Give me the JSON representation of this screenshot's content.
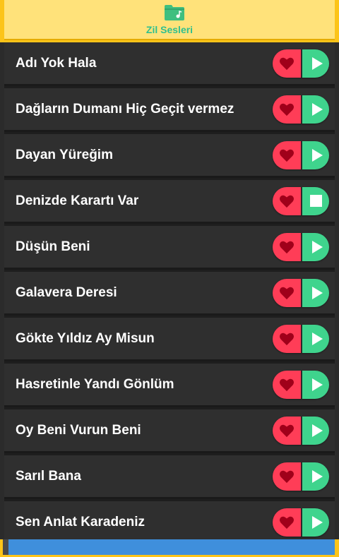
{
  "header": {
    "title": "Zil Sesleri",
    "icon": "folder-music-icon"
  },
  "colors": {
    "accent_yellow": "#fcc419",
    "title_green": "#2fbf8f",
    "favorite_red": "#ff3d57",
    "play_green": "#3fd48d"
  },
  "songs": [
    {
      "title": "Adı Yok Hala",
      "state": "play"
    },
    {
      "title": "Dağların Dumanı Hiç Geçit vermez",
      "state": "play"
    },
    {
      "title": "Dayan Yüreğim",
      "state": "play"
    },
    {
      "title": "Denizde Karartı Var",
      "state": "stop"
    },
    {
      "title": "Düşün Beni",
      "state": "play"
    },
    {
      "title": "Galavera Deresi",
      "state": "play"
    },
    {
      "title": "Gökte Yıldız Ay Misun",
      "state": "play"
    },
    {
      "title": "Hasretinle Yandı Gönlüm",
      "state": "play"
    },
    {
      "title": "Oy Beni Vurun Beni",
      "state": "play"
    },
    {
      "title": "Sarıl Bana",
      "state": "play"
    },
    {
      "title": "Sen Anlat Karadeniz",
      "state": "play"
    }
  ]
}
